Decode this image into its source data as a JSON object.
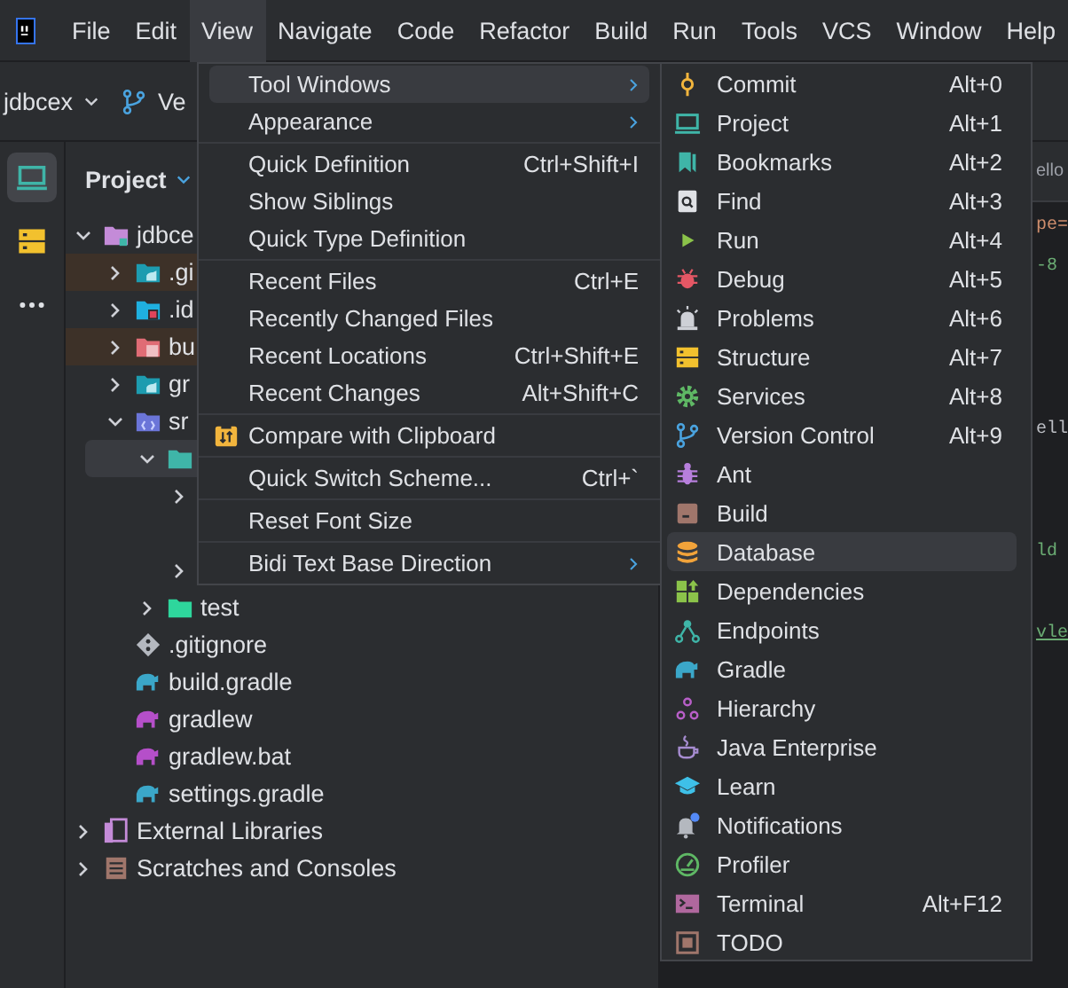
{
  "menubar": [
    {
      "label": "File",
      "selected": false
    },
    {
      "label": "Edit",
      "selected": false
    },
    {
      "label": "View",
      "selected": true
    },
    {
      "label": "Navigate",
      "selected": false
    },
    {
      "label": "Code",
      "selected": false
    },
    {
      "label": "Refactor",
      "selected": false
    },
    {
      "label": "Build",
      "selected": false
    },
    {
      "label": "Run",
      "selected": false
    },
    {
      "label": "Tools",
      "selected": false
    },
    {
      "label": "VCS",
      "selected": false
    },
    {
      "label": "Window",
      "selected": false
    },
    {
      "label": "Help",
      "selected": false
    }
  ],
  "toolbar": {
    "project": "jdbcex",
    "branch": "Ve"
  },
  "tool_strip": [
    {
      "kind": "project",
      "selected": true
    },
    {
      "kind": "structure",
      "selected": false
    },
    {
      "kind": "more",
      "selected": false
    }
  ],
  "project_panel": {
    "title": "Project",
    "tree": [
      {
        "label": "jdbce",
        "kind": "module",
        "expanded": true,
        "selected": false,
        "excluded": false,
        "children": [
          {
            "label": ".gi",
            "kind": "gradle",
            "expanded": false,
            "selected": false,
            "excluded": true
          },
          {
            "label": ".id",
            "kind": "idea",
            "expanded": false,
            "selected": false,
            "excluded": false
          },
          {
            "label": "bu",
            "kind": "excluded",
            "expanded": false,
            "selected": false,
            "excluded": true
          },
          {
            "label": "gr",
            "kind": "gradle",
            "expanded": false,
            "selected": false,
            "excluded": false
          },
          {
            "label": "sr",
            "kind": "source",
            "expanded": true,
            "selected": false,
            "excluded": false,
            "children": [
              {
                "kind": "folder",
                "expanded": true,
                "selected": true,
                "excluded": false,
                "children": [
                  {
                    "expanded": false,
                    "selected": false,
                    "excluded": false
                  },
                  {
                    "selected": false,
                    "excluded": false
                  },
                  {
                    "expanded": false,
                    "selected": false,
                    "excluded": false
                  }
                ]
              },
              {
                "label": "test",
                "kind": "test",
                "expanded": false,
                "selected": false,
                "excluded": false
              }
            ]
          },
          {
            "label": ".gitignore",
            "kind": "git",
            "selected": false,
            "excluded": false
          },
          {
            "label": "build.gradle",
            "kind": "gradlefile",
            "selected": false,
            "excluded": false
          },
          {
            "label": "gradlew",
            "kind": "script",
            "selected": false,
            "excluded": false
          },
          {
            "label": "gradlew.bat",
            "kind": "script",
            "selected": false,
            "excluded": false
          },
          {
            "label": "settings.gradle",
            "kind": "gradlefile",
            "selected": false,
            "excluded": false
          }
        ]
      },
      {
        "label": "External Libraries",
        "kind": "libraries",
        "expanded": false,
        "selected": false,
        "excluded": false
      },
      {
        "label": "Scratches and Consoles",
        "kind": "scratches",
        "expanded": false,
        "selected": false,
        "excluded": false
      }
    ]
  },
  "editor": {
    "tab": "ello",
    "lines": [
      {
        "kind": "keyword",
        "text": "pe="
      },
      {
        "kind": "string",
        "text": "-8"
      },
      {
        "kind": "blank"
      },
      {
        "kind": "blank"
      },
      {
        "kind": "blank"
      },
      {
        "kind": "plain",
        "text": "ell"
      },
      {
        "kind": "blank"
      },
      {
        "kind": "blank"
      },
      {
        "kind": "string",
        "text": "ld"
      },
      {
        "kind": "blank"
      },
      {
        "kind": "link",
        "text": "vle"
      }
    ]
  },
  "view_menu": {
    "groups": [
      [
        {
          "label": "Tool Windows",
          "submenu": true,
          "selected": true
        },
        {
          "label": "Appearance",
          "submenu": true,
          "selected": false
        }
      ],
      [
        {
          "label": "Quick Definition",
          "shortcut": "Ctrl+Shift+I",
          "submenu": false,
          "selected": false
        },
        {
          "label": "Show Siblings",
          "submenu": false,
          "selected": false
        },
        {
          "label": "Quick Type Definition",
          "submenu": false,
          "selected": false
        }
      ],
      [
        {
          "label": "Recent Files",
          "shortcut": "Ctrl+E",
          "submenu": false,
          "selected": false
        },
        {
          "label": "Recently Changed Files",
          "submenu": false,
          "selected": false
        },
        {
          "label": "Recent Locations",
          "shortcut": "Ctrl+Shift+E",
          "submenu": false,
          "selected": false
        },
        {
          "label": "Recent Changes",
          "shortcut": "Alt+Shift+C",
          "submenu": false,
          "selected": false
        }
      ],
      [
        {
          "label": "Compare with Clipboard",
          "icon": true,
          "submenu": false,
          "selected": false
        }
      ],
      [
        {
          "label": "Quick Switch Scheme...",
          "shortcut": "Ctrl+`",
          "submenu": false,
          "selected": false
        }
      ],
      [
        {
          "label": "Reset Font Size",
          "submenu": false,
          "selected": false
        }
      ],
      [
        {
          "label": "Bidi Text Base Direction",
          "submenu": true,
          "selected": false
        }
      ]
    ]
  },
  "tool_windows_menu": [
    {
      "label": "Commit",
      "kind": "commit",
      "shortcut": "Alt+0",
      "selected": false
    },
    {
      "label": "Project",
      "kind": "project",
      "shortcut": "Alt+1",
      "selected": false
    },
    {
      "label": "Bookmarks",
      "kind": "bookmarks",
      "shortcut": "Alt+2",
      "selected": false
    },
    {
      "label": "Find",
      "kind": "find",
      "shortcut": "Alt+3",
      "selected": false
    },
    {
      "label": "Run",
      "kind": "run",
      "shortcut": "Alt+4",
      "selected": false
    },
    {
      "label": "Debug",
      "kind": "debug",
      "shortcut": "Alt+5",
      "selected": false
    },
    {
      "label": "Problems",
      "kind": "problems",
      "shortcut": "Alt+6",
      "selected": false
    },
    {
      "label": "Structure",
      "kind": "structure",
      "shortcut": "Alt+7",
      "selected": false
    },
    {
      "label": "Services",
      "kind": "services",
      "shortcut": "Alt+8",
      "selected": false
    },
    {
      "label": "Version Control",
      "kind": "vcs",
      "shortcut": "Alt+9",
      "selected": false
    },
    {
      "label": "Ant",
      "kind": "ant",
      "selected": false
    },
    {
      "label": "Build",
      "kind": "build",
      "selected": false
    },
    {
      "label": "Database",
      "kind": "database",
      "selected": true
    },
    {
      "label": "Dependencies",
      "kind": "dependencies",
      "selected": false
    },
    {
      "label": "Endpoints",
      "kind": "endpoints",
      "selected": false
    },
    {
      "label": "Gradle",
      "kind": "gradle",
      "selected": false
    },
    {
      "label": "Hierarchy",
      "kind": "hierarchy",
      "selected": false
    },
    {
      "label": "Java Enterprise",
      "kind": "java",
      "selected": false
    },
    {
      "label": "Learn",
      "kind": "learn",
      "selected": false
    },
    {
      "label": "Notifications",
      "kind": "notifications",
      "selected": false
    },
    {
      "label": "Profiler",
      "kind": "profiler",
      "selected": false
    },
    {
      "label": "Terminal",
      "kind": "terminal",
      "shortcut": "Alt+F12",
      "selected": false
    },
    {
      "label": "TODO",
      "kind": "todo",
      "selected": false
    }
  ]
}
